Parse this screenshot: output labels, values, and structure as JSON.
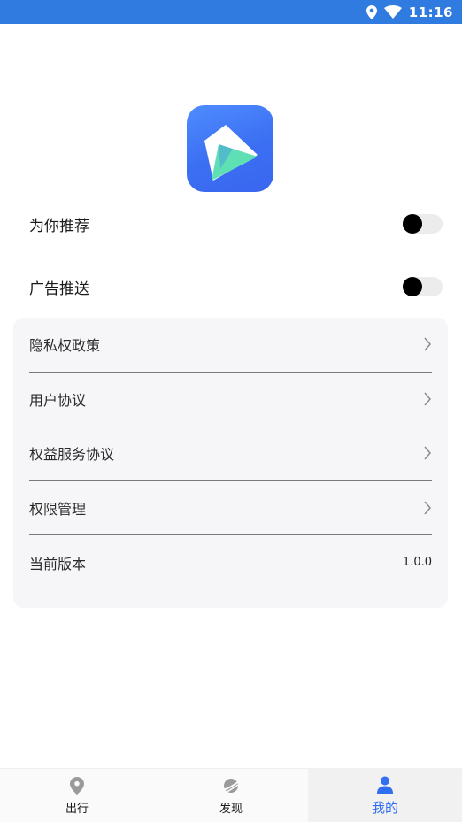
{
  "status_bar": {
    "time": "11:16",
    "icons": [
      "location-icon",
      "wifi-icon"
    ]
  },
  "logo": {
    "icon": "app-logo-icon",
    "colors": {
      "bg": "#3f78f5",
      "accent": "#5fe0b4",
      "white": "#ffffff"
    }
  },
  "settings": {
    "recommend_label": "为你推荐",
    "recommend_on": false,
    "ads_label": "广告推送",
    "ads_on": false
  },
  "menu": {
    "items": [
      {
        "label": "隐私权政策",
        "icon": "chevron-right-icon"
      },
      {
        "label": "用户协议",
        "icon": "chevron-right-icon"
      },
      {
        "label": "权益服务协议",
        "icon": "chevron-right-icon"
      },
      {
        "label": "权限管理",
        "icon": "chevron-right-icon"
      }
    ],
    "version_label": "当前版本",
    "version_value": "1.0.0"
  },
  "tabs": [
    {
      "label": "出行",
      "icon": "map-pin-icon",
      "active": false
    },
    {
      "label": "发现",
      "icon": "discover-icon",
      "active": false
    },
    {
      "label": "我的",
      "icon": "user-icon",
      "active": true
    }
  ],
  "colors": {
    "status_bar": "#2f7be0",
    "active_tab": "#2f6ff0",
    "card_bg": "#f6f6f8"
  }
}
